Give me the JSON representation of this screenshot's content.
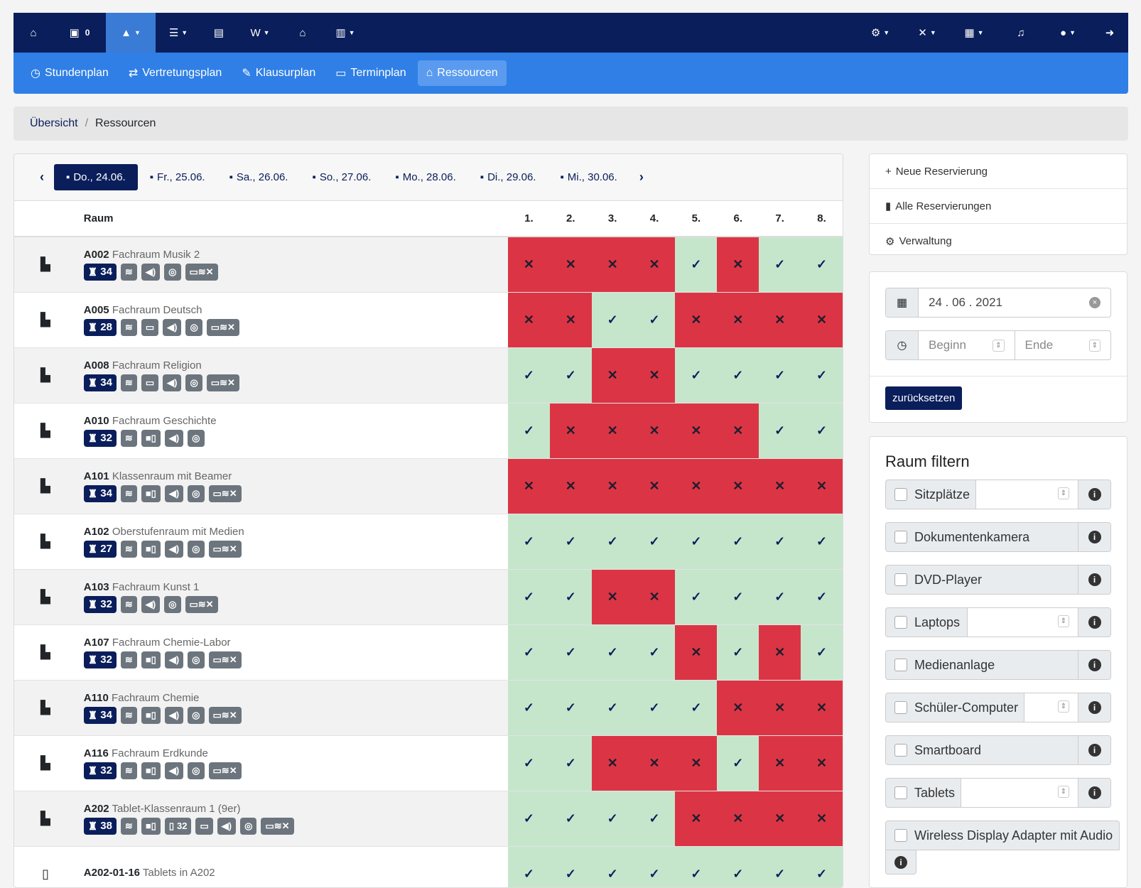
{
  "topnav": {
    "items": [
      {
        "icon": "home-icon",
        "glyph": "⌂"
      },
      {
        "icon": "inbox-icon",
        "glyph": "▣",
        "count": "0"
      },
      {
        "icon": "building-icon",
        "glyph": "▲",
        "active": true
      },
      {
        "icon": "list-icon",
        "glyph": "☰"
      },
      {
        "icon": "document-icon",
        "glyph": "▤"
      },
      {
        "icon": "wikipedia-icon",
        "glyph": "W"
      },
      {
        "icon": "house-icon",
        "glyph": "⌂"
      },
      {
        "icon": "book-icon",
        "glyph": "▥"
      }
    ],
    "right_items": [
      {
        "icon": "cogs-icon",
        "glyph": "⚙"
      },
      {
        "icon": "tools-icon",
        "glyph": "✕"
      },
      {
        "icon": "grid-icon",
        "glyph": "▦"
      },
      {
        "icon": "bell-icon",
        "glyph": "♫"
      },
      {
        "icon": "user-icon",
        "glyph": "●"
      },
      {
        "icon": "logout-icon",
        "glyph": "➜"
      }
    ]
  },
  "subnav": {
    "items": [
      {
        "label": "Stundenplan",
        "icon": "clock-icon",
        "glyph": "◷"
      },
      {
        "label": "Vertretungsplan",
        "icon": "shuffle-icon",
        "glyph": "⇄"
      },
      {
        "label": "Klausurplan",
        "icon": "edit-icon",
        "glyph": "✎"
      },
      {
        "label": "Terminplan",
        "icon": "calendar-icon",
        "glyph": "▭"
      },
      {
        "label": "Ressourcen",
        "icon": "resources-icon",
        "glyph": "⌂",
        "active": true
      }
    ]
  },
  "breadcrumb": {
    "home": "Übersicht",
    "current": "Ressourcen",
    "separator": "/"
  },
  "days": [
    {
      "label": "Do., 24.06.",
      "active": true
    },
    {
      "label": "Fr., 25.06."
    },
    {
      "label": "Sa., 26.06."
    },
    {
      "label": "So., 27.06."
    },
    {
      "label": "Mo., 28.06."
    },
    {
      "label": "Di., 29.06."
    },
    {
      "label": "Mi., 30.06."
    }
  ],
  "table": {
    "room_header": "Raum",
    "periods": [
      "1.",
      "2.",
      "3.",
      "4.",
      "5.",
      "6.",
      "7.",
      "8."
    ],
    "rows": [
      {
        "code": "A002",
        "name": "Fachraum Musik 2",
        "seats": "34",
        "badges": [
          "wifi",
          "speaker",
          "dvd",
          "display"
        ],
        "slots": [
          0,
          0,
          0,
          0,
          1,
          0,
          1,
          1
        ]
      },
      {
        "code": "A005",
        "name": "Fachraum Deutsch",
        "seats": "28",
        "badges": [
          "wifi",
          "laptop",
          "speaker",
          "dvd",
          "display"
        ],
        "slots": [
          0,
          0,
          1,
          1,
          0,
          0,
          0,
          0
        ]
      },
      {
        "code": "A008",
        "name": "Fachraum Religion",
        "seats": "34",
        "badges": [
          "wifi",
          "laptop",
          "speaker",
          "dvd",
          "display"
        ],
        "slots": [
          1,
          1,
          0,
          0,
          1,
          1,
          1,
          1
        ]
      },
      {
        "code": "A010",
        "name": "Fachraum Geschichte",
        "seats": "32",
        "badges": [
          "wifi",
          "doccam",
          "speaker",
          "dvd"
        ],
        "slots": [
          1,
          0,
          0,
          0,
          0,
          0,
          1,
          1
        ]
      },
      {
        "code": "A101",
        "name": "Klassenraum mit Beamer",
        "seats": "34",
        "badges": [
          "wifi",
          "doccam",
          "speaker",
          "dvd",
          "display"
        ],
        "slots": [
          0,
          0,
          0,
          0,
          0,
          0,
          0,
          0
        ]
      },
      {
        "code": "A102",
        "name": "Oberstufenraum mit Medien",
        "seats": "27",
        "badges": [
          "wifi",
          "doccam",
          "speaker",
          "dvd",
          "display"
        ],
        "slots": [
          1,
          1,
          1,
          1,
          1,
          1,
          1,
          1
        ]
      },
      {
        "code": "A103",
        "name": "Fachraum Kunst 1",
        "seats": "32",
        "badges": [
          "wifi",
          "speaker",
          "dvd",
          "display"
        ],
        "slots": [
          1,
          1,
          0,
          0,
          1,
          1,
          1,
          1
        ]
      },
      {
        "code": "A107",
        "name": "Fachraum Chemie-Labor",
        "seats": "32",
        "badges": [
          "wifi",
          "doccam",
          "speaker",
          "dvd",
          "display"
        ],
        "slots": [
          1,
          1,
          1,
          1,
          0,
          1,
          0,
          1
        ]
      },
      {
        "code": "A110",
        "name": "Fachraum Chemie",
        "seats": "34",
        "badges": [
          "wifi",
          "doccam",
          "speaker",
          "dvd",
          "display"
        ],
        "slots": [
          1,
          1,
          1,
          1,
          1,
          0,
          0,
          0
        ]
      },
      {
        "code": "A116",
        "name": "Fachraum Erdkunde",
        "seats": "32",
        "badges": [
          "wifi",
          "doccam",
          "speaker",
          "dvd",
          "display"
        ],
        "slots": [
          1,
          1,
          0,
          0,
          0,
          1,
          0,
          0
        ]
      },
      {
        "code": "A202",
        "name": "Tablet-Klassenraum 1 (9er)",
        "seats": "38",
        "tablets": "32",
        "badges": [
          "wifi",
          "doccam",
          "tablets",
          "laptop",
          "speaker",
          "dvd",
          "display"
        ],
        "slots": [
          1,
          1,
          1,
          1,
          0,
          0,
          0,
          0
        ]
      },
      {
        "code": "A202-01-16",
        "name": "Tablets in A202",
        "device": true,
        "badges": [],
        "slots": [
          1,
          1,
          1,
          1,
          1,
          1,
          1,
          1
        ]
      }
    ]
  },
  "sidebar": {
    "menu": [
      {
        "label": "Neue Reservierung",
        "icon": "plus-icon",
        "glyph": "+"
      },
      {
        "label": "Alle Reservierungen",
        "icon": "door-icon",
        "glyph": "▮"
      },
      {
        "label": "Verwaltung",
        "icon": "cogs-icon",
        "glyph": "⚙"
      }
    ],
    "date_value": "24 . 06 . 2021",
    "begin_placeholder": "Beginn",
    "end_placeholder": "Ende",
    "reset_label": "zurücksetzen",
    "filter_title": "Raum filtern",
    "filters": [
      {
        "label": "Sitzplätze",
        "number": true
      },
      {
        "label": "Dokumentenkamera"
      },
      {
        "label": "DVD-Player"
      },
      {
        "label": "Laptops",
        "number": true
      },
      {
        "label": "Medienanlage"
      },
      {
        "label": "Schüler-Computer",
        "number": true
      },
      {
        "label": "Smartboard"
      },
      {
        "label": "Tablets",
        "number": true
      },
      {
        "label": "Wireless Display Adapter mit Audio"
      }
    ]
  },
  "colors": {
    "navy": "#0a1e5b",
    "blue": "#2f7fe6",
    "free": "#c6e6cc",
    "busy": "#db3545"
  }
}
